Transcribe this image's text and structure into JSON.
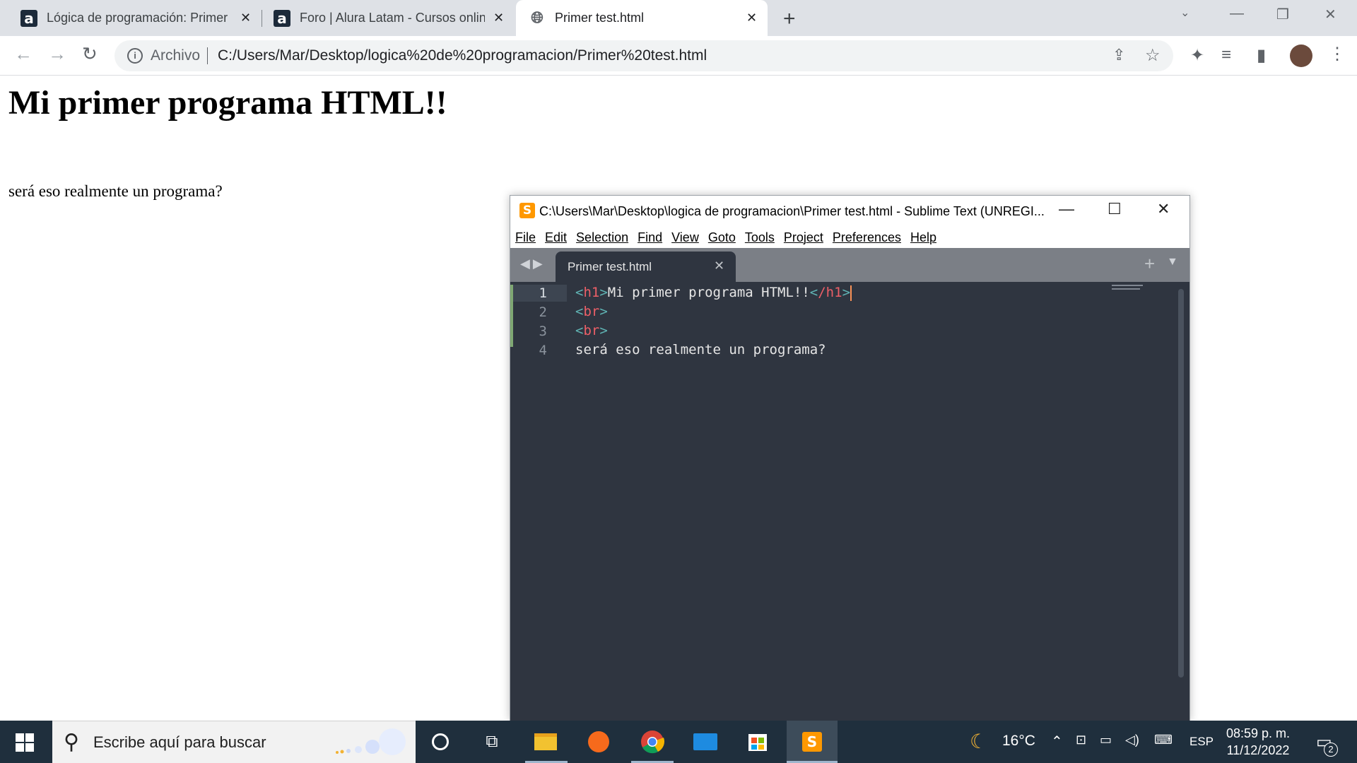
{
  "browser": {
    "tabs": [
      {
        "title": "Lógica de programación: Primer",
        "icon": "alura-icon"
      },
      {
        "title": "Foro | Alura Latam - Cursos onlin",
        "icon": "alura-icon"
      },
      {
        "title": "Primer test.html",
        "icon": "globe-icon",
        "active": true
      }
    ],
    "address_prefix": "Archivo",
    "url": "C:/Users/Mar/Desktop/logica%20de%20programacion/Primer%20test.html"
  },
  "page": {
    "heading": "Mi primer programa HTML!!",
    "text": "será eso realmente un programa?"
  },
  "sublime": {
    "title": "C:\\Users\\Mar\\Desktop\\logica de programacion\\Primer test.html - Sublime Text (UNREGI...",
    "menu": [
      "File",
      "Edit",
      "Selection",
      "Find",
      "View",
      "Goto",
      "Tools",
      "Project",
      "Preferences",
      "Help"
    ],
    "tab": "Primer test.html",
    "line_numbers": [
      "1",
      "2",
      "3",
      "4"
    ],
    "code": {
      "line1_open_tag": "h1",
      "line1_text": "Mi primer programa HTML!!",
      "line1_close_tag": "/h1",
      "line2_tag": "br",
      "line3_tag": "br",
      "line4_text": "será eso realmente un programa?"
    }
  },
  "taskbar": {
    "search_placeholder": "Escribe aquí para buscar",
    "temperature": "16°C",
    "language": "ESP",
    "time": "08:59 p. m.",
    "date": "11/12/2022",
    "notifications": "2"
  }
}
